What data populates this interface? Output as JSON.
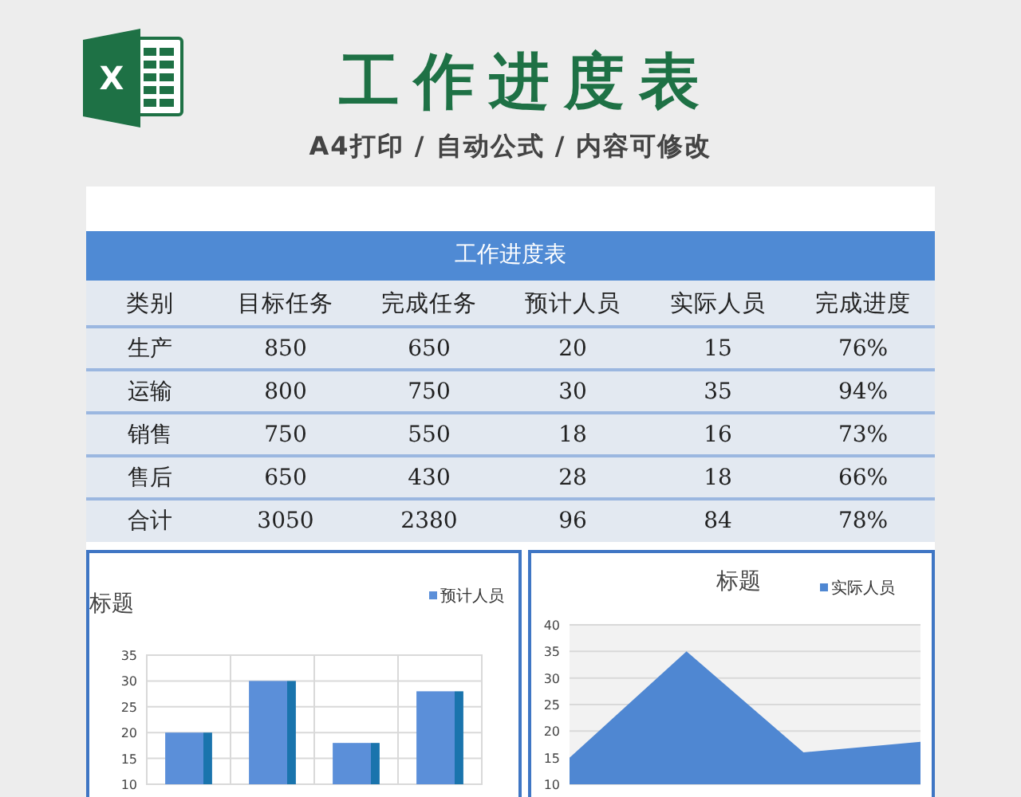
{
  "header": {
    "logo_letter": "X",
    "title": "工作进度表",
    "subtitle": "A4打印 / 自动公式 / 内容可修改"
  },
  "table": {
    "title": "工作进度表",
    "columns": [
      "类别",
      "目标任务",
      "完成任务",
      "预计人员",
      "实际人员",
      "完成进度"
    ],
    "rows": [
      [
        "生产",
        "850",
        "650",
        "20",
        "15",
        "76%"
      ],
      [
        "运输",
        "800",
        "750",
        "30",
        "35",
        "94%"
      ],
      [
        "销售",
        "750",
        "550",
        "18",
        "16",
        "73%"
      ],
      [
        "售后",
        "650",
        "430",
        "28",
        "18",
        "66%"
      ],
      [
        "合计",
        "3050",
        "2380",
        "96",
        "84",
        "78%"
      ]
    ]
  },
  "charts": [
    {
      "chart_data": {
        "type": "bar",
        "title": "标题",
        "series": [
          {
            "name": "预计人员",
            "color": "#5b8fd9",
            "values": [
              20,
              30,
              18,
              28
            ]
          }
        ],
        "ylim": [
          10,
          35
        ],
        "yticks": [
          10,
          15,
          20,
          25,
          30,
          35
        ],
        "grid": true
      }
    },
    {
      "chart_data": {
        "type": "area",
        "title": "标题",
        "series": [
          {
            "name": "实际人员",
            "color": "#4f87d2",
            "values": [
              15,
              35,
              16,
              18
            ]
          }
        ],
        "ylim": [
          10,
          40
        ],
        "yticks": [
          10,
          15,
          20,
          25,
          30,
          35,
          40
        ],
        "grid": true
      }
    }
  ]
}
